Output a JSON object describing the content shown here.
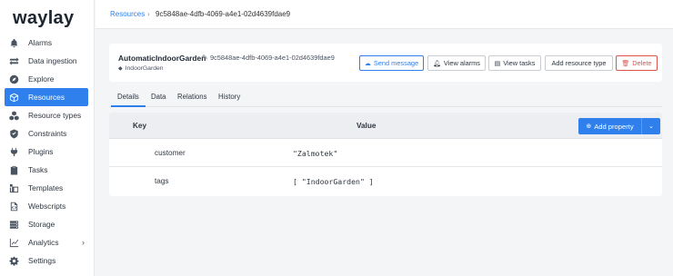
{
  "app": {
    "logo": "waylay"
  },
  "sidebar": {
    "items": [
      {
        "label": "Alarms",
        "icon": "bell-icon"
      },
      {
        "label": "Data ingestion",
        "icon": "arrows-exchange-icon"
      },
      {
        "label": "Explore",
        "icon": "compass-icon"
      },
      {
        "label": "Resources",
        "icon": "cube-icon",
        "active": true
      },
      {
        "label": "Resource types",
        "icon": "cubes-icon"
      },
      {
        "label": "Constraints",
        "icon": "shield-check-icon"
      },
      {
        "label": "Plugins",
        "icon": "plug-icon"
      },
      {
        "label": "Tasks",
        "icon": "clipboard-icon"
      },
      {
        "label": "Templates",
        "icon": "templates-icon"
      },
      {
        "label": "Webscripts",
        "icon": "code-file-icon"
      },
      {
        "label": "Storage",
        "icon": "database-icon"
      },
      {
        "label": "Analytics",
        "icon": "chart-icon",
        "chevron": "›"
      },
      {
        "label": "Settings",
        "icon": "gear-icon"
      }
    ]
  },
  "breadcrumb": {
    "root": "Resources",
    "separator": "›",
    "current": "9c5848ae-4dfb-4069-a4e1-02d4639fdae9"
  },
  "resource": {
    "name": "AutomaticIndoorGarden",
    "id": "9c5848ae-4dfb-4069-a4e1-02d4639fdae9",
    "tag": "IndoorGarden"
  },
  "actions": {
    "send_message": "Send message",
    "view_alarms": "View alarms",
    "view_tasks": "View tasks",
    "add_resource_type": "Add resource type",
    "delete": "Delete"
  },
  "tabs": [
    "Details",
    "Data",
    "Relations",
    "History"
  ],
  "table": {
    "col_key": "Key",
    "col_value": "Value",
    "add_property": "Add property",
    "rows": [
      {
        "key": "customer",
        "value": "\"Zalmotek\""
      },
      {
        "key": "tags",
        "value": "[ \"IndoorGarden\" ]"
      }
    ]
  },
  "colors": {
    "accent": "#2f80ed",
    "danger": "#e0524c",
    "sidebar_active": "#2f80ed"
  }
}
